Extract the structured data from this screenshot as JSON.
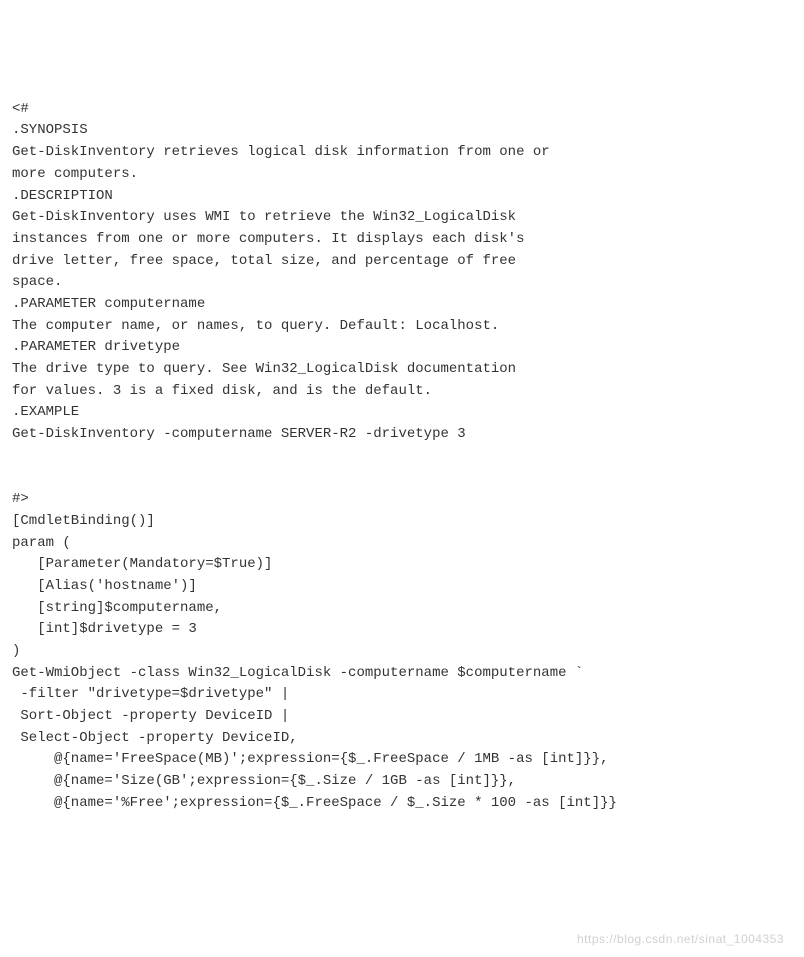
{
  "code": {
    "line01": "<#",
    "line02": ".SYNOPSIS",
    "line03": "Get-DiskInventory retrieves logical disk information from one or",
    "line04": "more computers.",
    "line05": ".DESCRIPTION",
    "line06": "Get-DiskInventory uses WMI to retrieve the Win32_LogicalDisk",
    "line07": "instances from one or more computers. It displays each disk's",
    "line08": "drive letter, free space, total size, and percentage of free",
    "line09": "space.",
    "line10": ".PARAMETER computername",
    "line11": "The computer name, or names, to query. Default: Localhost.",
    "line12": ".PARAMETER drivetype",
    "line13": "The drive type to query. See Win32_LogicalDisk documentation",
    "line14": "for values. 3 is a fixed disk, and is the default.",
    "line15": ".EXAMPLE",
    "line16": "Get-DiskInventory -computername SERVER-R2 -drivetype 3",
    "line17": "",
    "line18": "",
    "line19": "#>",
    "line20": "[CmdletBinding()]",
    "line21": "param (",
    "line22": "   [Parameter(Mandatory=$True)]",
    "line23": "   [Alias('hostname')]",
    "line24": "   [string]$computername,",
    "line25": "   [int]$drivetype = 3",
    "line26": ")",
    "line27": "Get-WmiObject -class Win32_LogicalDisk -computername $computername `",
    "line28": " -filter \"drivetype=$drivetype\" |",
    "line29": " Sort-Object -property DeviceID |",
    "line30": " Select-Object -property DeviceID,",
    "line31": "     @{name='FreeSpace(MB)';expression={$_.FreeSpace / 1MB -as [int]}},",
    "line32": "     @{name='Size(GB';expression={$_.Size / 1GB -as [int]}},",
    "line33": "     @{name='%Free';expression={$_.FreeSpace / $_.Size * 100 -as [int]}}"
  },
  "watermark": "https://blog.csdn.net/sinat_1004353"
}
